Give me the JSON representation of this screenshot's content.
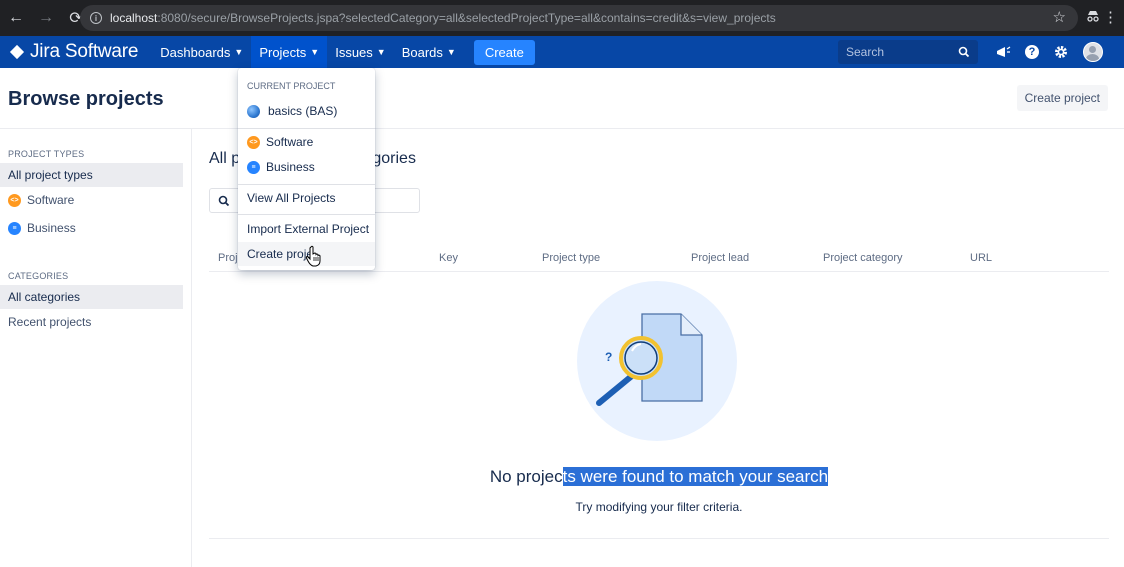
{
  "browser": {
    "url_host": "localhost",
    "url_rest": ":8080/secure/BrowseProjects.jspa?selectedCategory=all&selectedProjectType=all&contains=credit&s=view_projects"
  },
  "header": {
    "product": "Jira Software",
    "menu": {
      "dashboards": "Dashboards",
      "projects": "Projects",
      "issues": "Issues",
      "boards": "Boards"
    },
    "create": "Create",
    "search_placeholder": "Search"
  },
  "page": {
    "title": "Browse projects",
    "create_project": "Create project"
  },
  "sidebar": {
    "project_types_heading": "PROJECT TYPES",
    "project_types": [
      "All project types",
      "Software",
      "Business"
    ],
    "categories_heading": "CATEGORIES",
    "categories": [
      "All categories",
      "Recent projects"
    ]
  },
  "main": {
    "title_left": "All p",
    "title_right": "categories",
    "filter_value": "",
    "columns": [
      "Proje",
      "Key",
      "Project type",
      "Project lead",
      "Project category",
      "URL"
    ],
    "empty_title_plain": "No projec",
    "empty_title_highlight": "ts were found to match your search",
    "empty_subtitle": "Try modifying your filter criteria."
  },
  "dropdown": {
    "current_project_label": "CURRENT PROJECT",
    "current_project": "basics (BAS)",
    "types": [
      "Software",
      "Business"
    ],
    "view_all": "View All Projects",
    "import_external": "Import External Project",
    "create_project": "Create proje"
  },
  "colors": {
    "header_bg": "#0747a6",
    "active_menu": "#0052cc",
    "create_button": "#2684ff",
    "software_icon": "#ff991f",
    "business_icon": "#2684ff",
    "selection_highlight": "#2b6fd6"
  }
}
